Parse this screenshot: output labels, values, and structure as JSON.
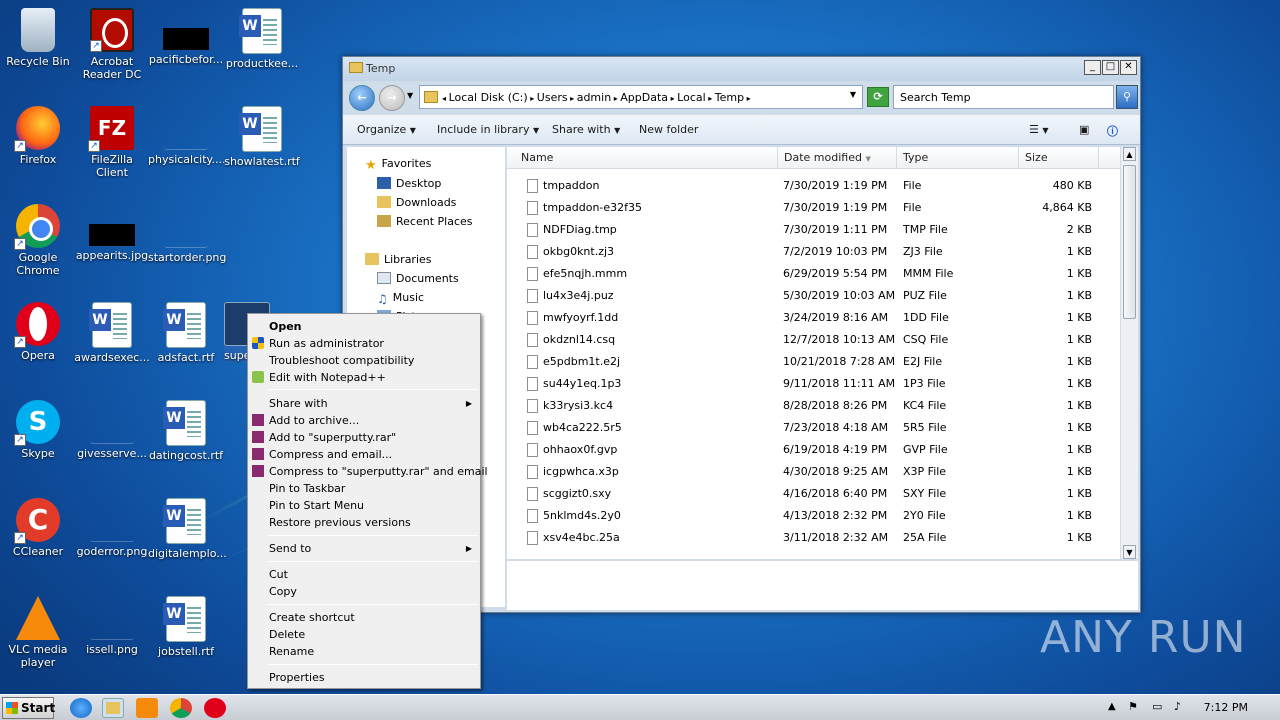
{
  "desktop": {
    "icons": [
      {
        "label": "Recycle Bin",
        "icon": "recycle-bin-icon"
      },
      {
        "label": "Acrobat Reader DC",
        "icon": "acrobat-icon"
      },
      {
        "label": "pacificbefor...",
        "icon": "image-file-icon"
      },
      {
        "label": "productkee...",
        "icon": "word-doc-icon"
      },
      {
        "label": "Firefox",
        "icon": "firefox-icon"
      },
      {
        "label": "FileZilla Client",
        "icon": "filezilla-icon"
      },
      {
        "label": "physicalcity....",
        "icon": "file-icon"
      },
      {
        "label": "showlatest.rtf",
        "icon": "word-doc-icon"
      },
      {
        "label": "Google Chrome",
        "icon": "chrome-icon"
      },
      {
        "label": "appearits.jpg",
        "icon": "image-file-icon"
      },
      {
        "label": "startorder.png",
        "icon": "image-file-icon"
      },
      {
        "label": "Opera",
        "icon": "opera-icon"
      },
      {
        "label": "awardsexec...",
        "icon": "word-doc-icon"
      },
      {
        "label": "adsfact.rtf",
        "icon": "word-doc-icon"
      },
      {
        "label": "supe",
        "icon": "application-icon"
      },
      {
        "label": "Skype",
        "icon": "skype-icon"
      },
      {
        "label": "givesserve...",
        "icon": "file-icon"
      },
      {
        "label": "datingcost.rtf",
        "icon": "word-doc-icon"
      },
      {
        "label": "CCleaner",
        "icon": "ccleaner-icon"
      },
      {
        "label": "goderror.png",
        "icon": "image-file-icon"
      },
      {
        "label": "digitalemplo...",
        "icon": "word-doc-icon"
      },
      {
        "label": "VLC media player",
        "icon": "vlc-icon"
      },
      {
        "label": "issell.png",
        "icon": "image-file-icon"
      },
      {
        "label": "jobstell.rtf",
        "icon": "word-doc-icon"
      }
    ]
  },
  "explorer": {
    "title": "Temp",
    "address": {
      "crumbs": [
        "Local Disk (C:)",
        "Users",
        "admin",
        "AppData",
        "Local",
        "Temp"
      ]
    },
    "search_placeholder": "Search Temp",
    "toolbar": {
      "organize": "Organize",
      "include_in_library": "Include in library",
      "share_with": "Share with",
      "new_folder": "New folder"
    },
    "nav": {
      "favorites": "Favorites",
      "desktop": "Desktop",
      "downloads": "Downloads",
      "recent_places": "Recent Places",
      "libraries": "Libraries",
      "documents": "Documents",
      "music": "Music",
      "pictures": "Pict"
    },
    "columns": {
      "name": "Name",
      "date_modified": "Date modified",
      "type": "Type",
      "size": "Size"
    },
    "files": [
      {
        "name": "tmpaddon",
        "date": "7/30/2019 1:19 PM",
        "type": "File",
        "size": "480 KB"
      },
      {
        "name": "tmpaddon-e32f35",
        "date": "7/30/2019 1:19 PM",
        "type": "File",
        "size": "4,864 KB"
      },
      {
        "name": "NDFDiag.tmp",
        "date": "7/30/2019 1:11 PM",
        "type": "TMP File",
        "size": "2 KB"
      },
      {
        "name": "okbg0knt.zj3",
        "date": "7/2/2019 10:03 PM",
        "type": "ZJ3 File",
        "size": "1 KB"
      },
      {
        "name": "efe5nqjh.mmm",
        "date": "6/29/2019 5:54 PM",
        "type": "MMM File",
        "size": "1 KB"
      },
      {
        "name": "lu4x3e4j.puz",
        "date": "5/30/2019 10:03 AM",
        "type": "PUZ File",
        "size": "1 KB"
      },
      {
        "name": "mwfyoyrf.1dd",
        "date": "3/24/2019 8:16 AM",
        "type": "1DD File",
        "size": "1 KB"
      },
      {
        "name": "okdznl14.csq",
        "date": "12/7/2018 10:13 AM",
        "type": "CSQ File",
        "size": "1 KB"
      },
      {
        "name": "e5pdbm1t.e2j",
        "date": "10/21/2018 7:28 AM",
        "type": "E2J File",
        "size": "1 KB"
      },
      {
        "name": "su44y1eq.1p3",
        "date": "9/11/2018 11:11 AM",
        "type": "1P3 File",
        "size": "1 KB"
      },
      {
        "name": "k33rysi3.kc4",
        "date": "8/28/2018 8:26 PM",
        "type": "KC4 File",
        "size": "1 KB"
      },
      {
        "name": "wb4ca222.5r5",
        "date": "7/23/2018 4:18 AM",
        "type": "5R5 File",
        "size": "1 KB"
      },
      {
        "name": "ohhaox0f.gvp",
        "date": "6/19/2018 4:19 PM",
        "type": "GVP File",
        "size": "1 KB"
      },
      {
        "name": "icgpwhca.x3p",
        "date": "4/30/2018 9:25 AM",
        "type": "X3P File",
        "size": "1 KB"
      },
      {
        "name": "scggizt0.sxy",
        "date": "4/16/2018 6:40 PM",
        "type": "SXY File",
        "size": "1 KB"
      },
      {
        "name": "5nklmd4s.2y0",
        "date": "4/13/2018 2:32 PM",
        "type": "2Y0 File",
        "size": "1 KB"
      },
      {
        "name": "xsv4e4bc.25a",
        "date": "3/11/2018 2:32 AM",
        "type": "25A File",
        "size": "1 KB"
      }
    ]
  },
  "context_menu": {
    "open": "Open",
    "run_as_admin": "Run as administrator",
    "troubleshoot": "Troubleshoot compatibility",
    "edit_notepad": "Edit with Notepad++",
    "share_with": "Share with",
    "add_archive": "Add to archive...",
    "add_rar": "Add to \"superputty.rar\"",
    "compress_email": "Compress and email...",
    "compress_rar_email": "Compress to \"superputty.rar\" and email",
    "pin_taskbar": "Pin to Taskbar",
    "pin_start": "Pin to Start Menu",
    "restore_versions": "Restore previous versions",
    "send_to": "Send to",
    "cut": "Cut",
    "copy": "Copy",
    "create_shortcut": "Create shortcut",
    "delete": "Delete",
    "rename": "Rename",
    "properties": "Properties"
  },
  "taskbar": {
    "start": "Start",
    "clock": "7:12 PM"
  },
  "watermark": "ANY RUN"
}
